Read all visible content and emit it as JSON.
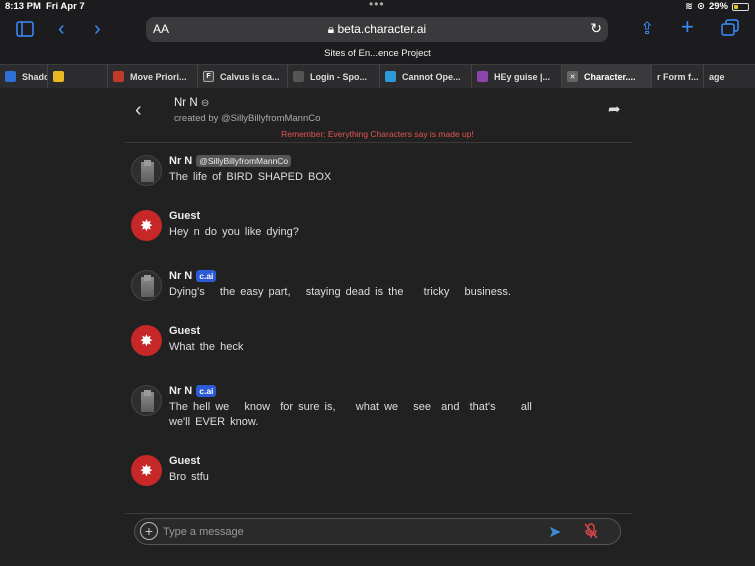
{
  "status_bar": {
    "time": "8:13 PM",
    "date": "Fri Apr 7",
    "battery": "29%"
  },
  "browser": {
    "aa_label": "AA",
    "url": "beta.character.ai",
    "page_title": "Sites of En...ence Project",
    "tabs": [
      {
        "label": "",
        "favicon_color": "#2e6fd8"
      },
      {
        "label": "Shadow",
        "favicon_color": "#e8b923"
      },
      {
        "label": "Move Priori...",
        "favicon_color": "#c0392b"
      },
      {
        "label": "Calvus is ca...",
        "favicon_color": "#444444"
      },
      {
        "label": "Login - Spo...",
        "favicon_color": "#555555"
      },
      {
        "label": "Cannot Ope...",
        "favicon_color": "#2a9bd6"
      },
      {
        "label": "HEy guise |...",
        "favicon_color": "#8e44ad"
      },
      {
        "label": "Character....",
        "favicon_color": "#666666",
        "active": true
      },
      {
        "label": "r Form f...",
        "favicon_color": "#555555"
      },
      {
        "label": "age",
        "favicon_color": "#555555"
      }
    ]
  },
  "chat": {
    "character_name": "Nr N",
    "created_by": "created by @SillyBillyfromMannCo",
    "disclaimer": "Remember: Everything Characters say is made up!",
    "input_placeholder": "Type a message",
    "messages": [
      {
        "author": "Nr N",
        "badge": "@SillyBillyfromMannCo",
        "badge_type": "handle",
        "text": "The life of BIRD SHAPED BOX"
      },
      {
        "author": "Guest",
        "text": "Hey n do you like dying?"
      },
      {
        "author": "Nr N",
        "badge": "c.ai",
        "badge_type": "cai",
        "text": "Dying's   the easy part,   staying dead is the    tricky   business."
      },
      {
        "author": "Guest",
        "text": "What the heck"
      },
      {
        "author": "Nr N",
        "badge": "c.ai",
        "badge_type": "cai",
        "text": "The hell we   know  for sure is,    what we   see  and  that's     all   we'll EVER know."
      },
      {
        "author": "Guest",
        "text": "Bro stfu"
      }
    ]
  },
  "colors": {
    "background": "#212121",
    "accent": "#3a8dff",
    "disclaimer": "#e25555",
    "cai_badge": "#2c5bd8",
    "guest_avatar": "#c62828"
  }
}
